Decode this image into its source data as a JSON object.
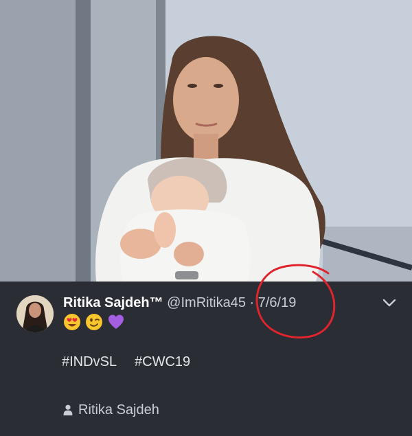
{
  "tweet": {
    "display_name": "Ritika Sajdeh™",
    "handle": "@ImRitika45",
    "separator": "·",
    "date": "7/6/19",
    "emojis": [
      "heart-eyes-emoji",
      "winking-face-emoji",
      "purple-heart-emoji"
    ],
    "hashtags": [
      "#INDvSL",
      "#CWC19"
    ],
    "tagged_user": "Ritika Sajdeh"
  },
  "colors": {
    "card_background": "#2a2d33",
    "text_primary": "#ffffff",
    "text_secondary": "#c9ced4",
    "annotation_red": "#e0242d"
  }
}
